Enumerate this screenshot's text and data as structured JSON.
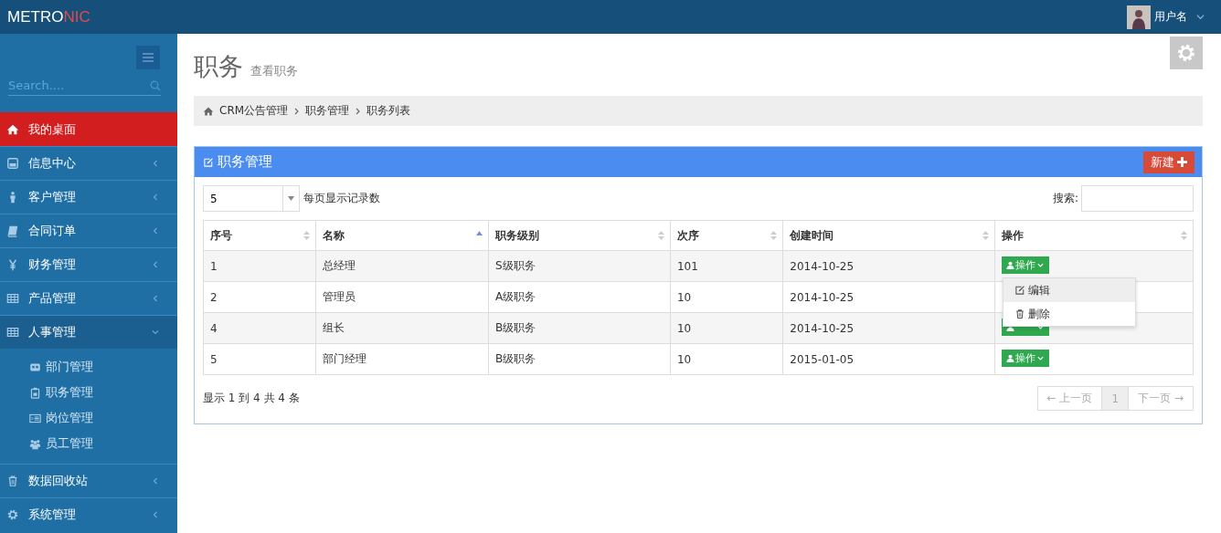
{
  "header": {
    "logo_main": "METRO",
    "logo_accent": "NIC",
    "user": "用户名"
  },
  "sidebar": {
    "search": {
      "placeholder": "Search...."
    },
    "items": [
      {
        "label": "我的桌面",
        "selected": true,
        "expanded": false
      },
      {
        "label": "信息中心",
        "selected": false,
        "expanded": false
      },
      {
        "label": "客户管理",
        "selected": false,
        "expanded": false
      },
      {
        "label": "合同订单",
        "selected": false,
        "expanded": false
      },
      {
        "label": "财务管理",
        "selected": false,
        "expanded": false
      },
      {
        "label": "产品管理",
        "selected": false,
        "expanded": false
      },
      {
        "label": "人事管理",
        "selected": false,
        "expanded": true,
        "children": [
          {
            "label": "部门管理"
          },
          {
            "label": "职务管理"
          },
          {
            "label": "岗位管理"
          },
          {
            "label": "员工管理"
          }
        ]
      },
      {
        "label": "数据回收站",
        "selected": false,
        "expanded": false
      },
      {
        "label": "系统管理",
        "selected": false,
        "expanded": false
      }
    ]
  },
  "page": {
    "title": "职务",
    "subtitle": "查看职务"
  },
  "breadcrumb": [
    "CRM公告管理",
    "职务管理",
    "职务列表"
  ],
  "portlet": {
    "title": "职务管理",
    "new_button": "新建",
    "page_size": "5",
    "page_size_label": "每页显示记录数",
    "search_label": "搜索:",
    "table": {
      "columns": [
        {
          "label": "序号",
          "sorted": false
        },
        {
          "label": "名称",
          "sorted": true
        },
        {
          "label": "职务级别",
          "sorted": false
        },
        {
          "label": "次序",
          "sorted": false
        },
        {
          "label": "创建时间",
          "sorted": false
        },
        {
          "label": "操作",
          "sorted": false
        }
      ],
      "rows": [
        {
          "cells": [
            "1",
            "总经理",
            "S级职务",
            "101",
            "2014-10-25"
          ],
          "action_button": true,
          "action": "操作"
        },
        {
          "cells": [
            "2",
            "管理员",
            "A级职务",
            "10",
            "2014-10-25"
          ],
          "action_button": false
        },
        {
          "cells": [
            "4",
            "组长",
            "B级职务",
            "10",
            "2014-10-25"
          ],
          "action_button": true
        },
        {
          "cells": [
            "5",
            "部门经理",
            "B级职务",
            "10",
            "2015-01-05"
          ],
          "action_button": true,
          "action": "操作"
        }
      ]
    },
    "menu": [
      {
        "label": "编辑",
        "selected": true
      },
      {
        "label": "删除",
        "selected": false
      }
    ],
    "info": "显示 1 到 4 共 4 条",
    "pagination": [
      {
        "label": "← 上一页",
        "selected": false,
        "disabled": true
      },
      {
        "label": "1",
        "selected": true,
        "disabled": false
      },
      {
        "label": "下一页 →",
        "selected": false,
        "disabled": true
      }
    ]
  }
}
